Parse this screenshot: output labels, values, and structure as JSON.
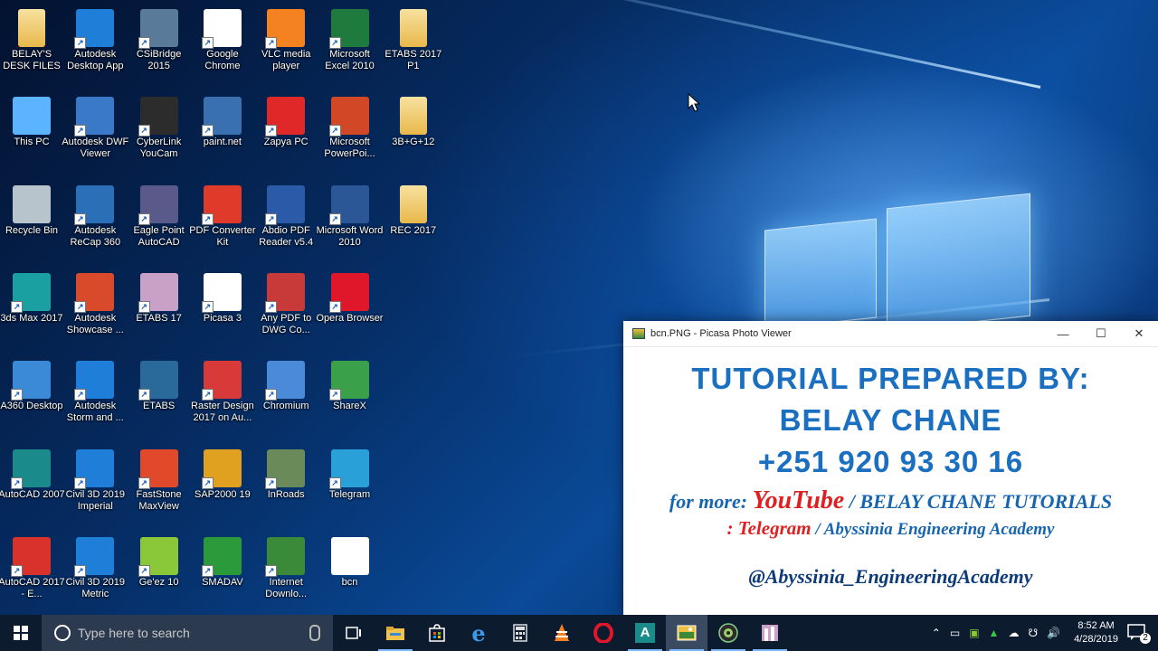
{
  "desktop": {
    "icons": [
      {
        "label": "BELAY'S DESK FILES",
        "icon": "folder-icon",
        "color": "#f2d27a"
      },
      {
        "label": "Autodesk Desktop App",
        "icon": "autodesk-app-icon",
        "color": "#1f7fd8"
      },
      {
        "label": "CSiBridge 2015",
        "icon": "csibridge-icon",
        "color": "#5a7a9a"
      },
      {
        "label": "Google Chrome",
        "icon": "chrome-icon",
        "color": "#ffffff"
      },
      {
        "label": "VLC media player",
        "icon": "vlc-icon",
        "color": "#f58220"
      },
      {
        "label": "Microsoft Excel 2010",
        "icon": "excel-icon",
        "color": "#1f7a3d"
      },
      {
        "label": "ETABS 2017 P1",
        "icon": "folder-icon",
        "color": "#f2d27a"
      },
      {
        "label": "This PC",
        "icon": "computer-icon",
        "color": "#5cb3ff"
      },
      {
        "label": "Autodesk DWF Viewer",
        "icon": "dwf-viewer-icon",
        "color": "#3a78c8"
      },
      {
        "label": "CyberLink YouCam",
        "icon": "youcam-icon",
        "color": "#2c2c2c"
      },
      {
        "label": "paint.net",
        "icon": "paintnet-icon",
        "color": "#3a6fb0"
      },
      {
        "label": "Zapya PC",
        "icon": "zapya-icon",
        "color": "#e02828"
      },
      {
        "label": "Microsoft PowerPoi...",
        "icon": "powerpoint-icon",
        "color": "#d24726"
      },
      {
        "label": "3B+G+12",
        "icon": "folder-icon",
        "color": "#f2d27a"
      },
      {
        "label": "Recycle Bin",
        "icon": "recycle-bin-icon",
        "color": "#b8c4cc"
      },
      {
        "label": "Autodesk ReCap 360",
        "icon": "recap-icon",
        "color": "#2a6fb8"
      },
      {
        "label": "Eagle Point AutoCAD",
        "icon": "eagle-point-icon",
        "color": "#5a5a8a"
      },
      {
        "label": "PDF Converter Kit",
        "icon": "pdf-converter-icon",
        "color": "#e03a2a"
      },
      {
        "label": "Abdio PDF Reader v5.4",
        "icon": "pdf-reader-icon",
        "color": "#2a5aa8"
      },
      {
        "label": "Microsoft Word 2010",
        "icon": "word-icon",
        "color": "#2b5797"
      },
      {
        "label": "REC 2017",
        "icon": "folder-icon",
        "color": "#f2c24a"
      },
      {
        "label": "3ds Max 2017",
        "icon": "3dsmax-icon",
        "color": "#1aa0a0"
      },
      {
        "label": "Autodesk Showcase ...",
        "icon": "showcase-icon",
        "color": "#d84a2a"
      },
      {
        "label": "ETABS 17",
        "icon": "etabs-icon",
        "color": "#c8a0c8"
      },
      {
        "label": "Picasa 3",
        "icon": "picasa-icon",
        "color": "#ffffff"
      },
      {
        "label": "Any PDF to DWG Co...",
        "icon": "pdf-to-dwg-icon",
        "color": "#c83a3a"
      },
      {
        "label": "Opera Browser",
        "icon": "opera-icon",
        "color": "#e0162b"
      },
      {
        "label": "A360 Desktop",
        "icon": "a360-icon",
        "color": "#3a8ad8"
      },
      {
        "label": "Autodesk Storm and ...",
        "icon": "storm-sanitary-icon",
        "color": "#1f7fd8"
      },
      {
        "label": "ETABS",
        "icon": "etabs-city-icon",
        "color": "#2a6a9a"
      },
      {
        "label": "Raster Design 2017 on Au...",
        "icon": "raster-design-icon",
        "color": "#d83a3a"
      },
      {
        "label": "Chromium",
        "icon": "chromium-icon",
        "color": "#4a8ad8"
      },
      {
        "label": "ShareX",
        "icon": "sharex-icon",
        "color": "#3aa04a"
      },
      {
        "label": "AutoCAD 2007",
        "icon": "autocad-2007-icon",
        "color": "#1a8a8a"
      },
      {
        "label": "Civil 3D 2019 Imperial",
        "icon": "civil3d-icon",
        "color": "#1f7fd8"
      },
      {
        "label": "FastStone MaxView",
        "icon": "faststone-icon",
        "color": "#e04a2a"
      },
      {
        "label": "SAP2000 19",
        "icon": "sap2000-icon",
        "color": "#e0a020"
      },
      {
        "label": "InRoads",
        "icon": "inroads-icon",
        "color": "#6a8a5a"
      },
      {
        "label": "Telegram",
        "icon": "telegram-icon",
        "color": "#2aa0d8"
      },
      {
        "label": "AutoCAD 2017 - E...",
        "icon": "autocad-icon",
        "color": "#d8322a"
      },
      {
        "label": "Civil 3D 2019 Metric",
        "icon": "civil3d-icon",
        "color": "#1f7fd8"
      },
      {
        "label": "Ge'ez 10",
        "icon": "geez-icon",
        "color": "#8ac83a"
      },
      {
        "label": "SMADAV",
        "icon": "smadav-icon",
        "color": "#2a9a3a"
      },
      {
        "label": "Internet Downlo...",
        "icon": "idm-icon",
        "color": "#3a8a3a"
      },
      {
        "label": "bcn",
        "icon": "image-file-icon",
        "color": "#ffffff"
      }
    ]
  },
  "viewer": {
    "title": "bcn.PNG - Picasa Photo Viewer",
    "line1": "TUTORIAL  PREPARED BY:",
    "line2": "BELAY CHANE",
    "line3": "+251 920 93 30 16",
    "promo_prefix": "for more: ",
    "promo_youtube": "YouTube",
    "promo_channel": " / BELAY CHANE TUTORIALS",
    "promo_telegram": ": Telegram",
    "promo_academy": " / Abyssinia Engineering Academy",
    "handle": "@Abyssinia_EngineeringAcademy"
  },
  "taskbar": {
    "search_placeholder": "Type here to search",
    "time": "8:52 AM",
    "date": "4/28/2019",
    "notification_count": "2",
    "apps": [
      "task-view-icon",
      "file-explorer-icon",
      "store-icon",
      "edge-icon",
      "calculator-icon",
      "vlc-icon",
      "opera-icon",
      "autocad-icon",
      "picasa-viewer-icon",
      "youcam-icon",
      "etabs-icon"
    ]
  }
}
